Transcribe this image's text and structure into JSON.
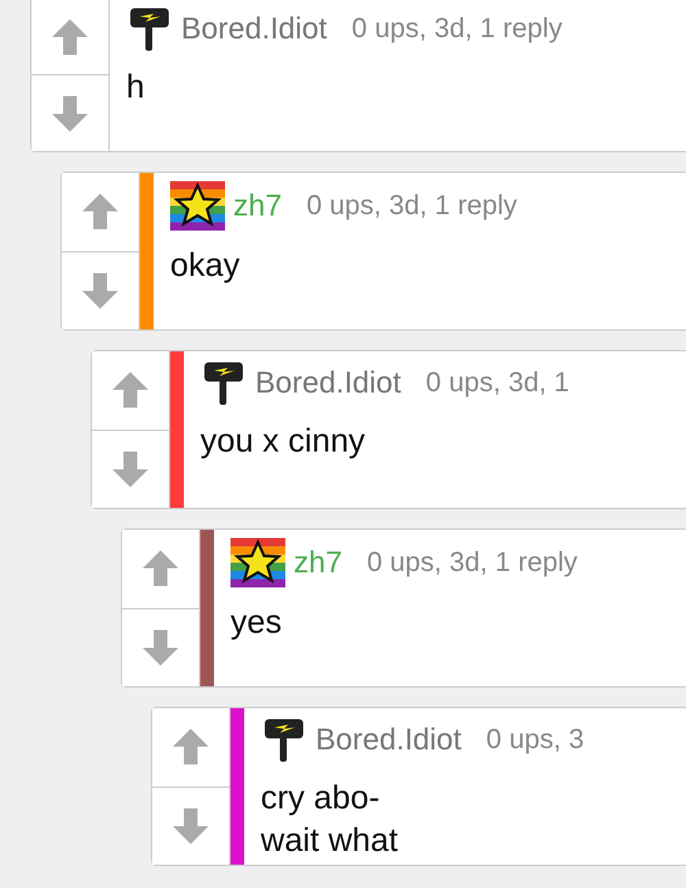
{
  "comments": [
    {
      "avatar": {
        "kind": "flag"
      },
      "author": {
        "name": "Bored.Idiot",
        "color": "#777777"
      },
      "meta": "0 ups, 3d, 1 reply",
      "body": "h",
      "children": [
        {
          "avatar": {
            "kind": "rainbow-star"
          },
          "author": {
            "name": "zh7",
            "color": "#4caf50"
          },
          "meta": "0 ups, 3d, 1 reply",
          "body": "okay",
          "color": "#ff8c00",
          "children": [
            {
              "avatar": {
                "kind": "flag"
              },
              "author": {
                "name": "Bored.Idiot",
                "color": "#777777"
              },
              "meta": "0 ups, 3d, 1",
              "body": "you x cinny",
              "color": "#ff3b3b",
              "children": [
                {
                  "avatar": {
                    "kind": "rainbow-star"
                  },
                  "author": {
                    "name": "zh7",
                    "color": "#4caf50"
                  },
                  "meta": "0 ups, 3d, 1 reply",
                  "body": "yes",
                  "color": "#a05555",
                  "children": [
                    {
                      "avatar": {
                        "kind": "flag"
                      },
                      "author": {
                        "name": "Bored.Idiot",
                        "color": "#777777"
                      },
                      "meta": "0 ups, 3",
                      "body": "cry abo-\nwait what",
                      "color": "#dd11cc"
                    }
                  ]
                }
              ]
            }
          ]
        }
      ]
    }
  ]
}
